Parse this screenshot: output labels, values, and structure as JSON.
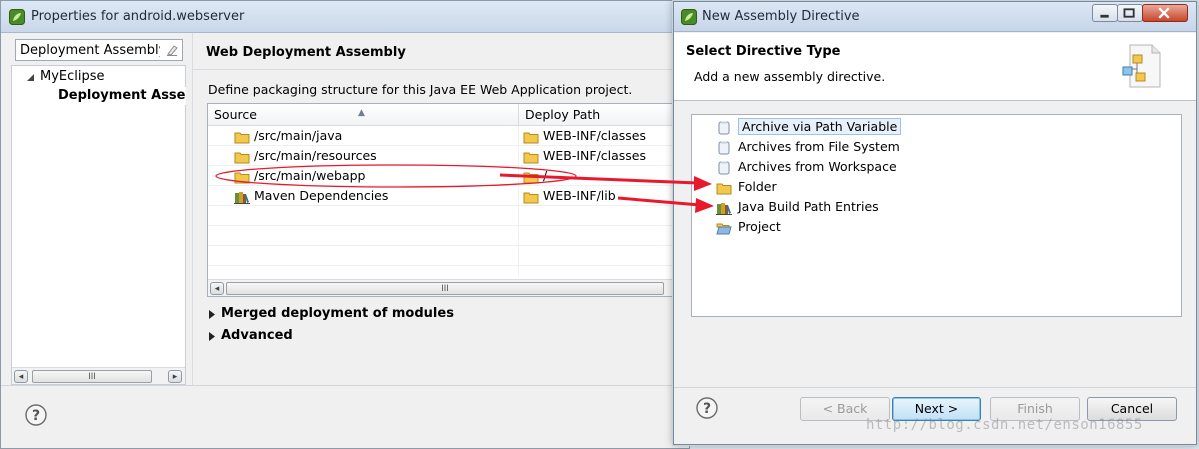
{
  "properties_window": {
    "title": "Properties for android.webserver",
    "filter_value": "Deployment Assembly",
    "tree": [
      {
        "label": "MyEclipse"
      },
      {
        "label": "Deployment Assembl"
      }
    ],
    "scroll_thumb_glyph": "III",
    "panel_title": "Web Deployment Assembly",
    "description": "Define packaging structure for this Java EE Web Application project.",
    "columns": [
      "Source",
      "Deploy Path"
    ],
    "rows": [
      {
        "source": "/src/main/java",
        "deploy": "WEB-INF/classes"
      },
      {
        "source": "/src/main/resources",
        "deploy": "WEB-INF/classes"
      },
      {
        "source": "/src/main/webapp",
        "deploy": "/"
      },
      {
        "source": "Maven Dependencies",
        "deploy": "WEB-INF/lib"
      }
    ],
    "sections": [
      "Merged deployment of modules",
      "Advanced"
    ],
    "help_glyph": "?"
  },
  "dialog": {
    "title": "New Assembly Directive",
    "banner_title": "Select Directive Type",
    "banner_desc": "Add a new assembly directive.",
    "items": [
      {
        "label": "Archive via Path Variable",
        "icon": "jar-icon"
      },
      {
        "label": "Archives from File System",
        "icon": "jar-icon"
      },
      {
        "label": "Archives from Workspace",
        "icon": "jar-icon"
      },
      {
        "label": "Folder",
        "icon": "folder-icon"
      },
      {
        "label": "Java Build Path Entries",
        "icon": "library-icon"
      },
      {
        "label": "Project",
        "icon": "open-folder-icon"
      }
    ],
    "buttons": {
      "back": "< Back",
      "next": "Next >",
      "finish": "Finish",
      "cancel": "Cancel"
    },
    "help_glyph": "?"
  },
  "watermark": "http://blog.csdn.net/enson16855",
  "colors": {
    "annotation_red": "#e8192c",
    "folder_yellow": "#f2c94c",
    "selection_blue": "#9dc1e7"
  }
}
